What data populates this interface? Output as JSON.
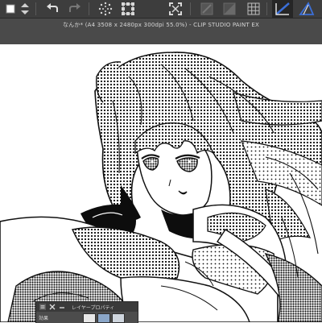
{
  "window": {
    "title": "なんか* (A4 3508 x 2480px 300dpi 55.0%) - CLIP STUDIO PAINT EX"
  },
  "toolbar": {
    "buttons": [
      {
        "name": "main-color-swatch",
        "icon": "color-square-icon"
      },
      {
        "name": "color-swap-arrows",
        "icon": "up-down-arrows-icon"
      },
      {
        "name": "undo-button",
        "icon": "undo-icon"
      },
      {
        "name": "redo-button",
        "icon": "redo-icon"
      },
      {
        "name": "selection-clear-button",
        "icon": "dotted-burst-icon"
      },
      {
        "name": "transform-button",
        "icon": "scale-icon"
      },
      {
        "name": "selection-crop-button",
        "icon": "crop-corners-icon"
      },
      {
        "name": "fill-disabled-button",
        "icon": "fill-icon"
      },
      {
        "name": "gradient-disabled-button",
        "icon": "gradient-icon"
      },
      {
        "name": "grid-button",
        "icon": "grid-icon"
      },
      {
        "name": "ruler-active-button",
        "icon": "ruler-icon"
      },
      {
        "name": "perspective-button",
        "icon": "perspective-icon"
      }
    ],
    "accent_color": "#3b6fd8"
  },
  "layer_property_panel": {
    "title": "レイヤープロパティ",
    "effect_label": "効果",
    "swatch_colors": [
      "#e8e8e8",
      "#8aa6c8",
      "#cfd6de"
    ]
  },
  "canvas": {
    "background": "#ffffff",
    "line_color": "#111111",
    "screentone": "halftone-dots"
  }
}
